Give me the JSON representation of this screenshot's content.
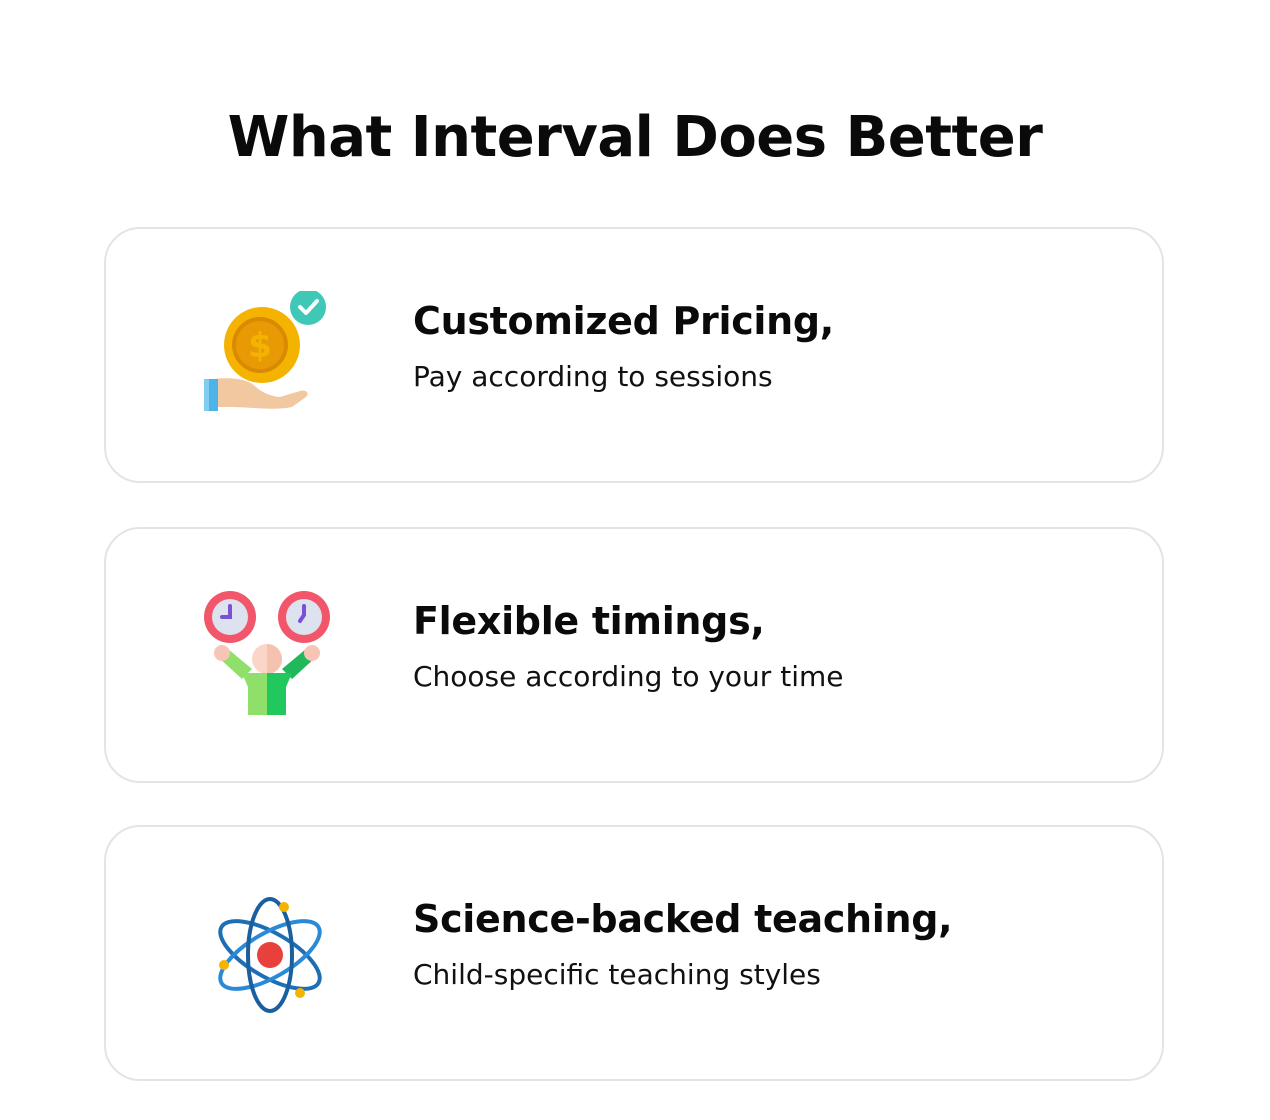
{
  "page": {
    "title": "What Interval Does Better"
  },
  "features": [
    {
      "heading": "Customized Pricing,",
      "description": "Pay according to sessions",
      "icon": "hand-coin-check-icon"
    },
    {
      "heading": "Flexible timings,",
      "description": "Choose according to your time",
      "icon": "person-juggling-clocks-icon"
    },
    {
      "heading": "Science-backed teaching,",
      "description": "Child-specific teaching styles",
      "icon": "atom-icon"
    }
  ],
  "colors": {
    "coin_gold": "#f5b301",
    "check_teal": "#3ec8b5",
    "clock_red": "#f2566b",
    "shirt_green": "#3cd66a",
    "atom_blue": "#1d6fb5",
    "nucleus_red": "#e8413c",
    "card_border": "#e4e4e4"
  }
}
